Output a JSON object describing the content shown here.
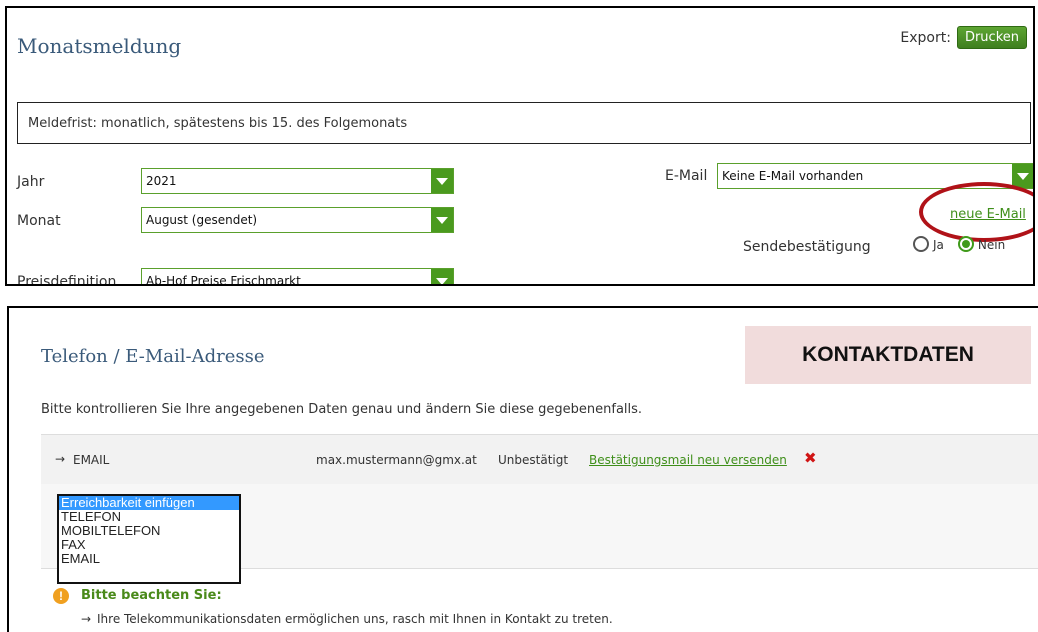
{
  "monthly": {
    "title": "Monatsmeldung",
    "export_label": "Export:",
    "print_button": "Drucken",
    "deadline_notice": "Meldefrist: monatlich, spätestens bis 15. des Folgemonats",
    "year_label": "Jahr",
    "year_value": "2021",
    "month_label": "Monat",
    "month_value": "August (gesendet)",
    "price_label": "Preisdefinition",
    "price_value": "Ab-Hof Preise Frischmarkt",
    "email_label": "E-Mail",
    "email_value": "Keine E-Mail vorhanden",
    "new_email_link": "neue E-Mail",
    "confirmation_label": "Sendebestätigung",
    "radio_yes": "Ja",
    "radio_no": "Nein",
    "radio_selected": "Nein",
    "highlight_color": "#b01218"
  },
  "contact": {
    "title": "Telefon / E-Mail-Adresse",
    "badge": "KONTAKTDATEN",
    "description": "Bitte kontrollieren Sie Ihre angegebenen Daten genau und ändern Sie diese gegebenenfalls.",
    "row": {
      "arrow": "→",
      "type": "EMAIL",
      "address": "max.mustermann@gmx.at",
      "status": "Unbestätigt",
      "resend_link": "Bestätigungsmail neu versenden",
      "delete_icon": "✖"
    },
    "dropdown_options": [
      "Erreichbarkeit einfügen",
      "TELEFON",
      "MOBILTELEFON",
      "FAX",
      "EMAIL"
    ],
    "dropdown_selected": "Erreichbarkeit einfügen",
    "note_icon": "!",
    "note_title": "Bitte beachten Sie:",
    "note_arrow": "→",
    "note_text": "Ihre Telekommunikationsdaten ermöglichen uns, rasch mit Ihnen in Kontakt zu treten."
  },
  "colors": {
    "accent_green": "#4a9a1e",
    "badge_bg": "#f1dcdc",
    "title_blue": "#3a5a7a",
    "delete_red": "#d01515",
    "selection_blue": "#3399ff"
  }
}
